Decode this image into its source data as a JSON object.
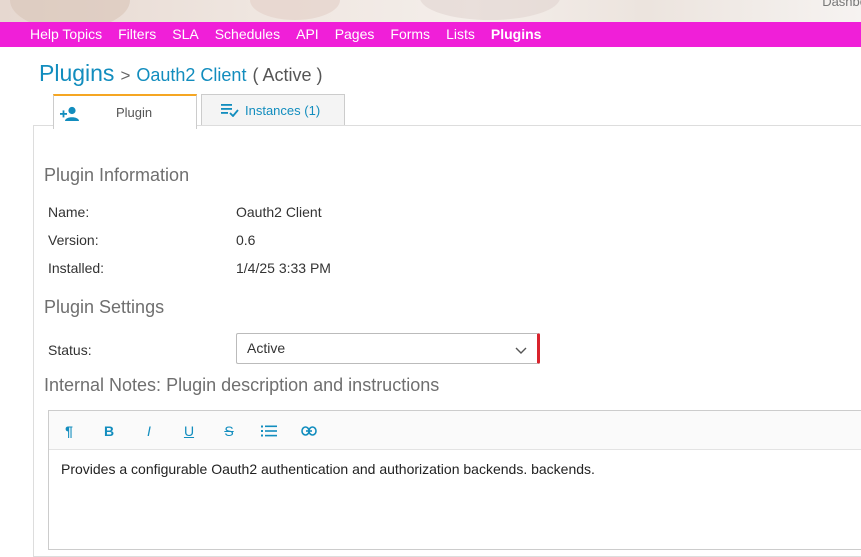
{
  "header": {
    "dashboard_link": "Dashbo"
  },
  "nav": {
    "items": [
      {
        "label": "Help Topics"
      },
      {
        "label": "Filters"
      },
      {
        "label": "SLA"
      },
      {
        "label": "Schedules"
      },
      {
        "label": "API"
      },
      {
        "label": "Pages"
      },
      {
        "label": "Forms"
      },
      {
        "label": "Lists"
      },
      {
        "label": "Plugins"
      }
    ],
    "active": "Plugins"
  },
  "breadcrumb": {
    "root": "Plugins",
    "separator": ">",
    "name": "Oauth2 Client",
    "status": "( Active )"
  },
  "tabs": {
    "plugin": "Plugin",
    "instances": "Instances (1)"
  },
  "info": {
    "title": "Plugin Information",
    "name_label": "Name:",
    "name_value": "Oauth2 Client",
    "version_label": "Version:",
    "version_value": "0.6",
    "installed_label": "Installed:",
    "installed_value": "1/4/25 3:33 PM"
  },
  "settings": {
    "title": "Plugin Settings",
    "status_label": "Status:",
    "status_value": "Active"
  },
  "notes": {
    "title": "Internal Notes: Plugin description and instructions",
    "toolbar": {
      "paragraph": "¶",
      "bold": "B",
      "italic": "I",
      "underline": "U",
      "strike": "S"
    },
    "content": "Provides a configurable Oauth2 authentication and authorization backends. backends."
  },
  "colors": {
    "nav_bg": "#f01fd8",
    "link": "#128dbe",
    "tab_accent": "#f5a623",
    "required": "#d9232d"
  }
}
